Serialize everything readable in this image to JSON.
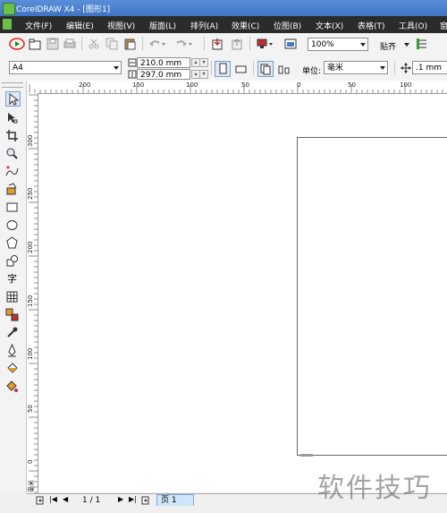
{
  "window": {
    "title": "CorelDRAW X4 - [图形1]"
  },
  "menu": {
    "items": [
      "文件(F)",
      "编辑(E)",
      "视图(V)",
      "版面(L)",
      "排列(A)",
      "效果(C)",
      "位图(B)",
      "文本(X)",
      "表格(T)",
      "工具(O)",
      "窗"
    ]
  },
  "standard_toolbar": {
    "zoom": "100%",
    "snap_label": "贴齐"
  },
  "property_bar": {
    "paper_size": "A4",
    "width": "210.0 mm",
    "height": "297.0 mm",
    "unit_label": "单位:",
    "unit": "毫米",
    "nudge": ".1 mm"
  },
  "ruler": {
    "horizontal": [
      "200",
      "150",
      "100",
      "50",
      "0",
      "50",
      "100"
    ],
    "vertical": [
      "300",
      "250",
      "200",
      "150",
      "100",
      "50",
      "0"
    ],
    "corner_label": "毫米"
  },
  "page_nav": {
    "page_count": "1 / 1",
    "tab_label": "页 1"
  },
  "watermark": "软件技巧",
  "colors": {
    "titlebar": "#3f73c4",
    "menubar": "#2b2b2b",
    "highlight_circle": "#e02020"
  }
}
